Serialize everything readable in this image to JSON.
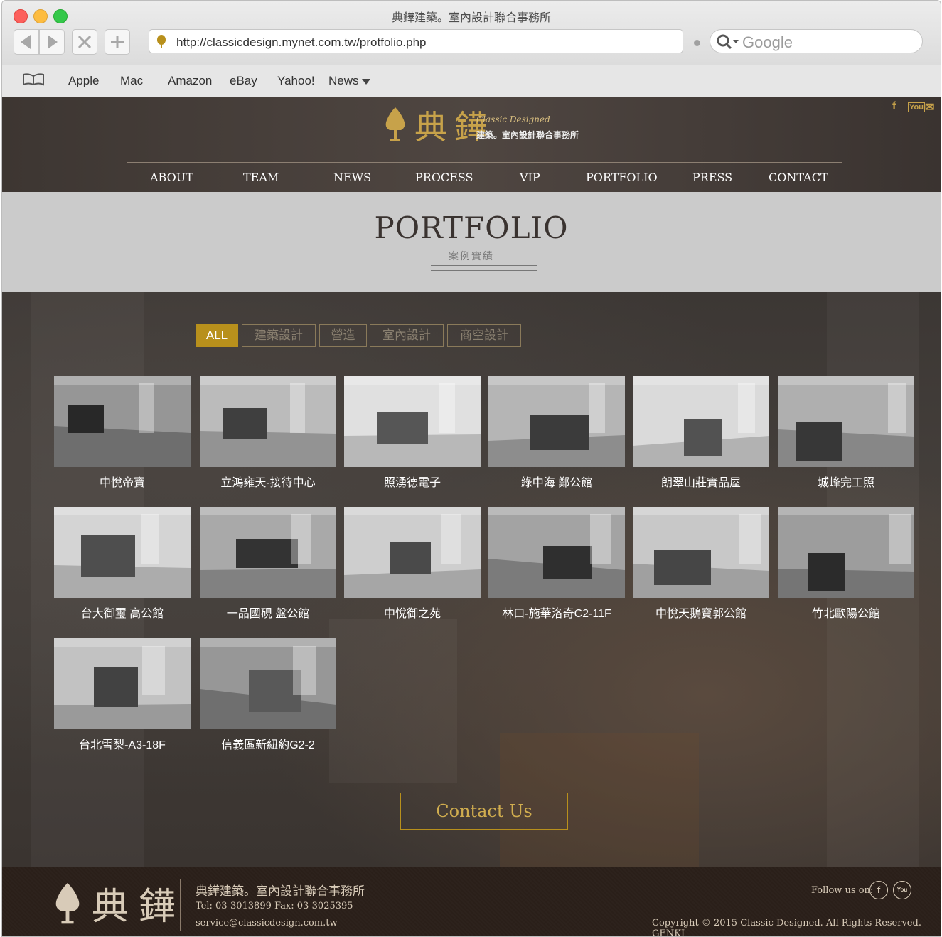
{
  "browser": {
    "window_title": "典鏵建築。室內設計聯合事務所",
    "url": "http://classicdesign.mynet.com.tw/protfolio.php",
    "search_placeholder": "Google",
    "bookmarks": [
      "Apple",
      "Mac",
      "Amazon",
      "eBay",
      "Yahoo!",
      "News"
    ]
  },
  "header": {
    "logo_cn": "典鏵",
    "logo_script": "Classic Designed",
    "logo_sub": "建築。室內設計聯合事務所",
    "social": [
      "f",
      "You",
      "✉"
    ],
    "nav": [
      "ABOUT",
      "TEAM",
      "NEWS",
      "PROCESS",
      "VIP",
      "PORTFOLIO",
      "PRESS",
      "CONTACT"
    ]
  },
  "portfolio": {
    "title": "PORTFOLIO",
    "subtitle": "案例實績",
    "filters": [
      "ALL",
      "建築設計",
      "營造",
      "室內設計",
      "商空設計"
    ],
    "active_filter": "ALL",
    "items": [
      "中悅帝寶",
      "立鴻雍天-接待中心",
      "照湧德電子",
      "綠中海 鄭公館",
      "朗翠山莊實品屋",
      "城峰完工照",
      "台大御璽 高公館",
      "一品國硯 盤公館",
      "中悅御之苑",
      "林口-施華洛奇C2-11F",
      "中悅天鵝寶郭公館",
      "竹北歐陽公館",
      "台北雪梨-A3-18F",
      "信義區新紐約G2-2"
    ],
    "contact_button": "Contact Us"
  },
  "footer": {
    "logo_cn": "典鏵",
    "company": "典鏵建築。室內設計聯合事務所",
    "tel": "Tel: 03-3013899 Fax: 03-3025395",
    "email": "service@classicdesign.com.tw",
    "follow": "Follow us on:",
    "social": [
      "f",
      "You"
    ],
    "copyright": "Copyright © 2015 Classic Designed. All Rights Reserved. GENKI"
  },
  "colors": {
    "accent_gold": "#b8901c",
    "header_bg": "#4a423d",
    "title_band": "#cbcbcb",
    "footer_bg": "#2a1f19"
  }
}
